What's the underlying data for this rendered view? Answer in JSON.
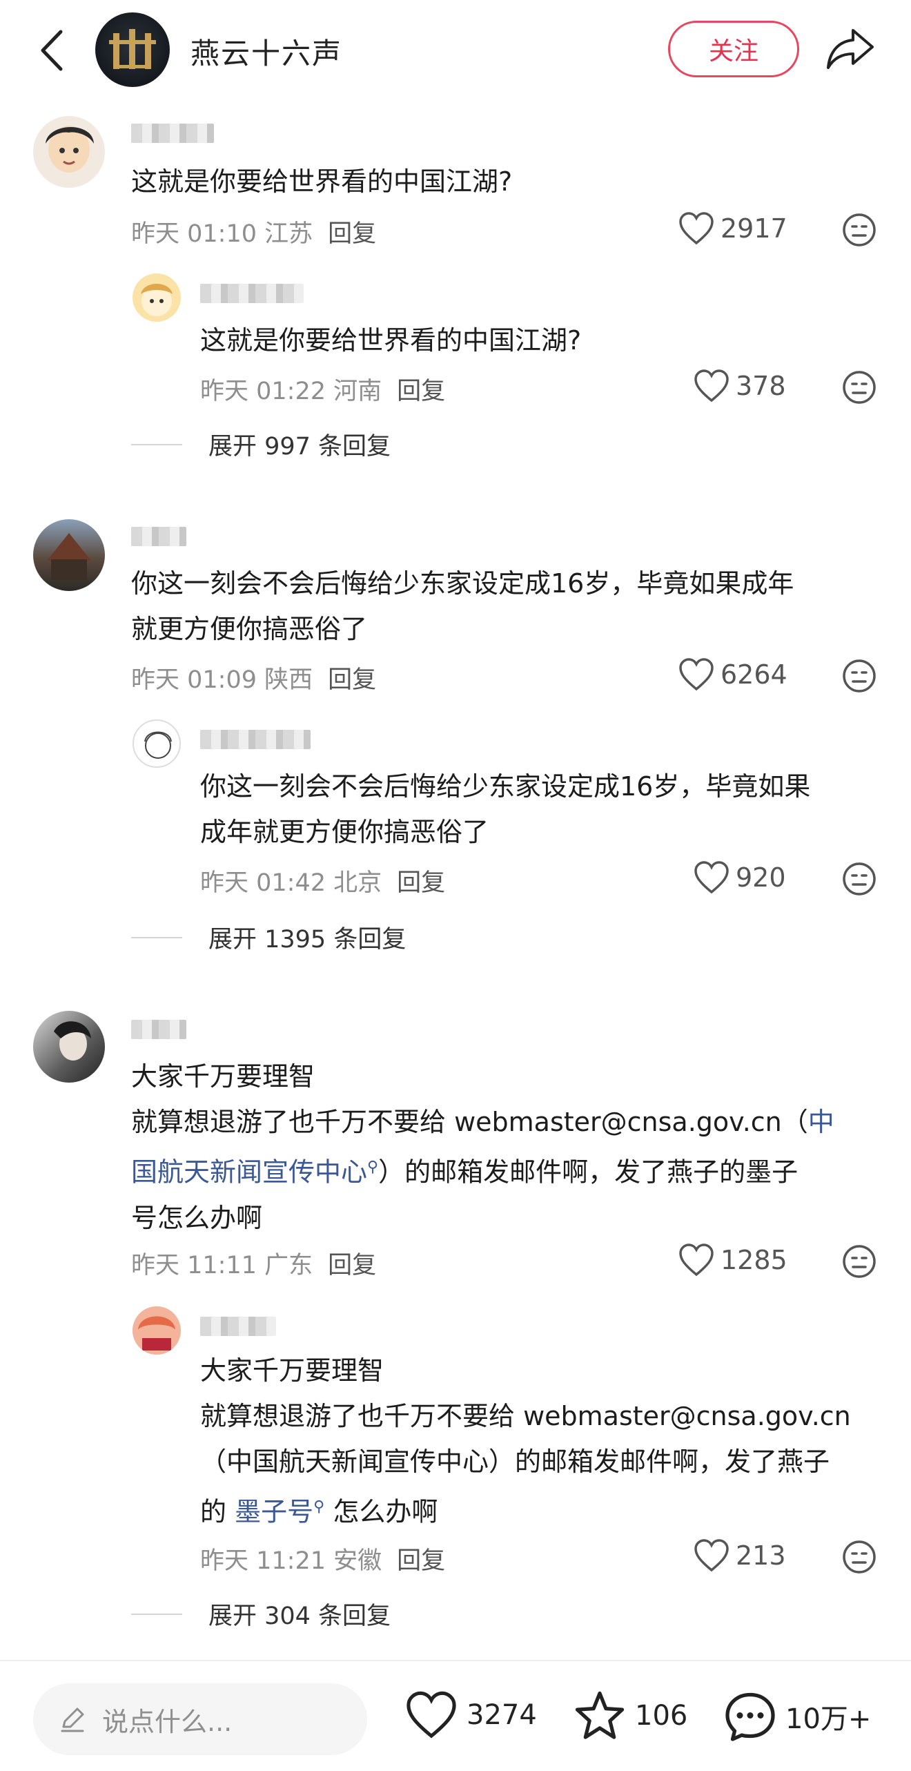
{
  "header": {
    "title": "燕云十六声",
    "follow_label": "关注"
  },
  "comments": [
    {
      "username": "猫猫王",
      "text": "这就是你要给世界看的中国江湖?",
      "meta_time": "昨天 01:10 江苏",
      "reply_label": "回复",
      "likes": "2917",
      "reply": {
        "username": "莆",
        "text": "这就是你要给世界看的中国江湖?",
        "meta_time": "昨天 01:22 河南",
        "reply_label": "回复",
        "likes": "378"
      },
      "expand_label": "展开 997 条回复"
    },
    {
      "username": "T",
      "text_lines": [
        "你这一刻会不会后悔给少东家设定成16岁，毕竟如果成年",
        "就更方便你搞恶俗了"
      ],
      "meta_time": "昨天 01:09 陕西",
      "reply_label": "回复",
      "likes": "6264",
      "reply": {
        "username": "白酒",
        "text_lines": [
          "你这一刻会不会后悔给少东家设定成16岁，毕竟如果",
          "成年就更方便你搞恶俗了"
        ],
        "meta_time": "昨天 01:42 北京",
        "reply_label": "回复",
        "likes": "920"
      },
      "expand_label": "展开 1395 条回复"
    },
    {
      "username": "桃子",
      "line1": "大家千万要理智",
      "line2_pre": "就算想退游了也千万不要给 webmaster@cnsa.gov.cn（",
      "line2_link": "中",
      "line3_link": "国航天新闻宣传中心",
      "line3_post": "）的邮箱发邮件啊，发了燕子的墨子",
      "line4": "号怎么办啊",
      "meta_time": "昨天 11:11 广东",
      "reply_label": "回复",
      "likes": "1285",
      "reply": {
        "username": "",
        "line1": "大家千万要理智",
        "line2": "就算想退游了也千万不要给 webmaster@cnsa.gov.cn",
        "line3": "（中国航天新闻宣传中心）的邮箱发邮件啊，发了燕子",
        "line4_pre": "的 ",
        "line4_link": "墨子号",
        "line4_post": " 怎么办啊",
        "meta_time": "昨天 11:21 安徽",
        "reply_label": "回复",
        "likes": "213"
      },
      "expand_label": "展开 304 条回复"
    }
  ],
  "bottom_bar": {
    "input_placeholder": "说点什么...",
    "likes": "3274",
    "favorites": "106",
    "comments": "10万+"
  },
  "colors": {
    "accent": "#e8304f",
    "link": "#3a5896",
    "meta": "#8e8e8e"
  }
}
